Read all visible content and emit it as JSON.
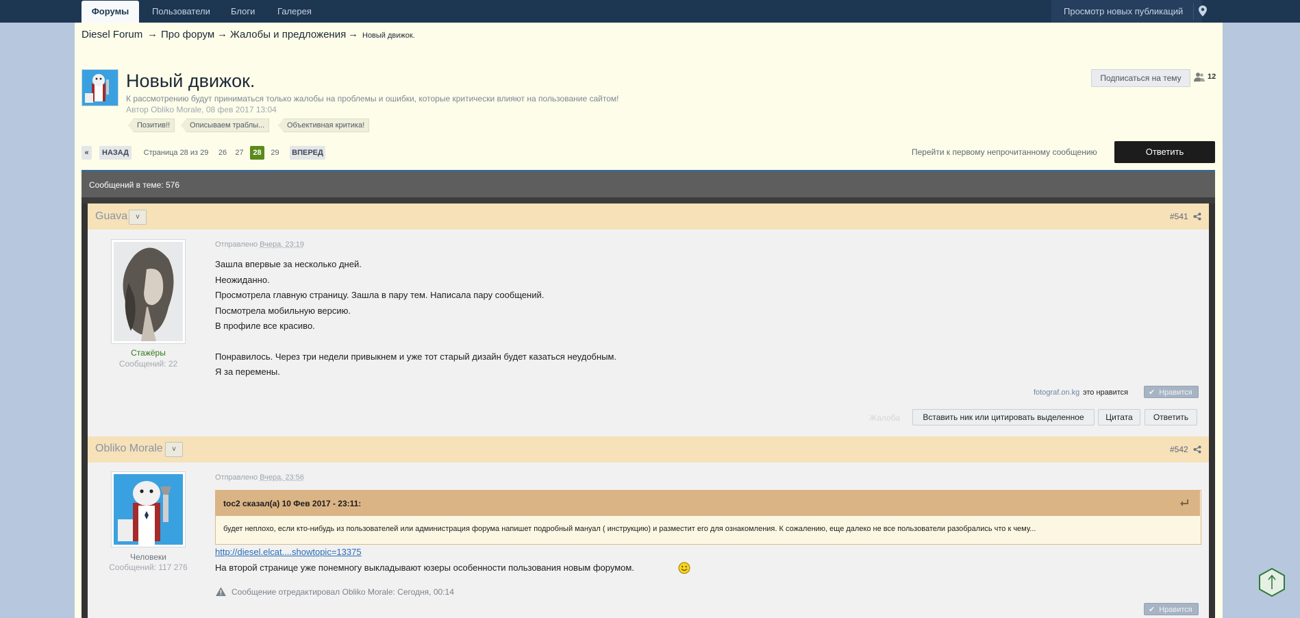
{
  "nav": {
    "tabs": [
      "Форумы",
      "Пользователи",
      "Блоги",
      "Галерея"
    ],
    "new_posts": "Просмотр новых публикаций",
    "pin_icon": "map-pin-icon"
  },
  "breadcrumb": {
    "items": [
      "Diesel Forum",
      "Про форум",
      "Жалобы и предложения"
    ],
    "current": "Новый движок.",
    "separator": "→"
  },
  "topic": {
    "title": "Новый движок.",
    "description": "К рассмотрению будут приниматься только жалобы на проблемы и ошибки, которые критически влияют на пользование сайтом!",
    "author_line": "Автор Obliko Morale, 08 фев 2017 13:04",
    "tags": [
      "Позитив!!",
      "Описываем траблы...",
      "Объективная критика!"
    ],
    "subscribe": "Подписаться на тему",
    "followers": "12"
  },
  "pagination": {
    "first": "«",
    "back": "НАЗАД",
    "page_of": "Страница 28 из 29",
    "pages": [
      "26",
      "27",
      "28",
      "29"
    ],
    "current": "28",
    "next": "ВПЕРЕД",
    "jump_unread": "Перейти к первому непрочитанному сообщению",
    "reply": "Ответить"
  },
  "posts_header": "Сообщений в теме: 576",
  "posts": [
    {
      "author": "Guava",
      "dropdown": "v",
      "number": "#541",
      "posted_label": "Отправлено",
      "posted_date": "Вчера, 23:19",
      "group": "Стажёры",
      "post_count": "Сообщений: 22",
      "lines": [
        "Зашла впервые за несколько дней.",
        "Неожиданно.",
        "Просмотрела главную страницу. Зашла в пару тем. Написала пару сообщений.",
        "Посмотрела мобильную версию.",
        "В профиле все красиво.",
        "Понравилось. Через три недели привыкнем и уже тот старый дизайн будет казаться неудобным.",
        "Я за перемены."
      ],
      "liker": "fotograf.on.kg",
      "likes_suffix": "это нравится",
      "like": "Нравится",
      "report": "Жалоба",
      "multiquote": "Вставить ник или цитировать выделенное",
      "quote": "Цитата",
      "reply": "Ответить"
    },
    {
      "author": "Obliko Morale",
      "dropdown": "v",
      "number": "#542",
      "posted_label": "Отправлено",
      "posted_date": "Вчера, 23:56",
      "group": "Человеки",
      "post_count": "Сообщений: 117 276",
      "quote_citation": "toc2 сказал(а) 10 Фев 2017 - 23:11:",
      "quote_text": "будет неплохо, если кто-нибудь из пользователей  или администрация форума напишет подробный  мануал ( инструкцию) и разместит его для ознакомления. К сожалению, еще далеко не все пользователи разобрались что к чему...",
      "link": "http://diesel.elcat....showtopic=13375",
      "text": "На второй странице уже понемногу выкладывают юзеры особенности пользования новым форумом.",
      "edit_note": "Сообщение отредактировал Obliko Morale: Сегодня, 00:14",
      "like": "Нравится"
    }
  ],
  "colors": {
    "topbar": "#1d3652",
    "page_bg": "#b7c7dd",
    "content_bg": "#fdfde9",
    "post_header": "#f6e1b9",
    "current_page": "#5a8a1c",
    "group_trainee": "#2f7a1d"
  }
}
